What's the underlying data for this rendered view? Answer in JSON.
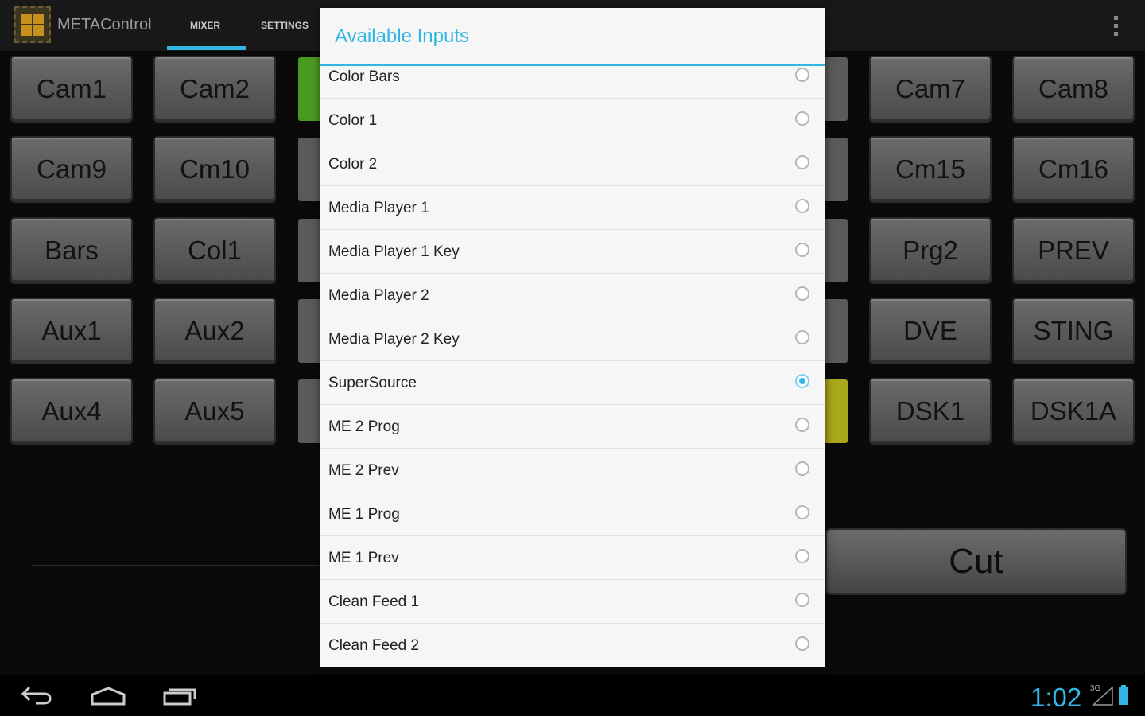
{
  "app": {
    "title": "METAControl",
    "tabs": [
      "MIXER",
      "SETTINGS"
    ],
    "active_tab": "MIXER",
    "accent_color": "#33b5e5"
  },
  "buttons": {
    "row1": [
      "Cam1",
      "Cam2",
      "Cam7",
      "Cam8"
    ],
    "row2": [
      "Cam9",
      "Cm10",
      "Cm15",
      "Cm16"
    ],
    "row3": [
      "Bars",
      "Col1",
      "Prg2",
      "PREV"
    ],
    "row4": [
      "Aux1",
      "Aux2",
      "DVE",
      "STING"
    ],
    "row5": [
      "Aux4",
      "Aux5",
      "DSK1",
      "DSK1A"
    ],
    "cut_label": "Cut"
  },
  "dialog": {
    "title": "Available Inputs",
    "items": [
      {
        "label": "Color Bars",
        "selected": false
      },
      {
        "label": "Color 1",
        "selected": false
      },
      {
        "label": "Color 2",
        "selected": false
      },
      {
        "label": "Media Player 1",
        "selected": false
      },
      {
        "label": "Media Player 1 Key",
        "selected": false
      },
      {
        "label": "Media Player 2",
        "selected": false
      },
      {
        "label": "Media Player 2 Key",
        "selected": false
      },
      {
        "label": "SuperSource",
        "selected": true
      },
      {
        "label": "ME 2 Prog",
        "selected": false
      },
      {
        "label": "ME 2 Prev",
        "selected": false
      },
      {
        "label": "ME 1 Prog",
        "selected": false
      },
      {
        "label": "ME 1 Prev",
        "selected": false
      },
      {
        "label": "Clean Feed 1",
        "selected": false
      },
      {
        "label": "Clean Feed 2",
        "selected": false
      }
    ]
  },
  "status_bar": {
    "time": "1:02",
    "network": "3G"
  },
  "nav": {
    "icons": [
      "back-icon",
      "home-icon",
      "recent-apps-icon"
    ]
  }
}
